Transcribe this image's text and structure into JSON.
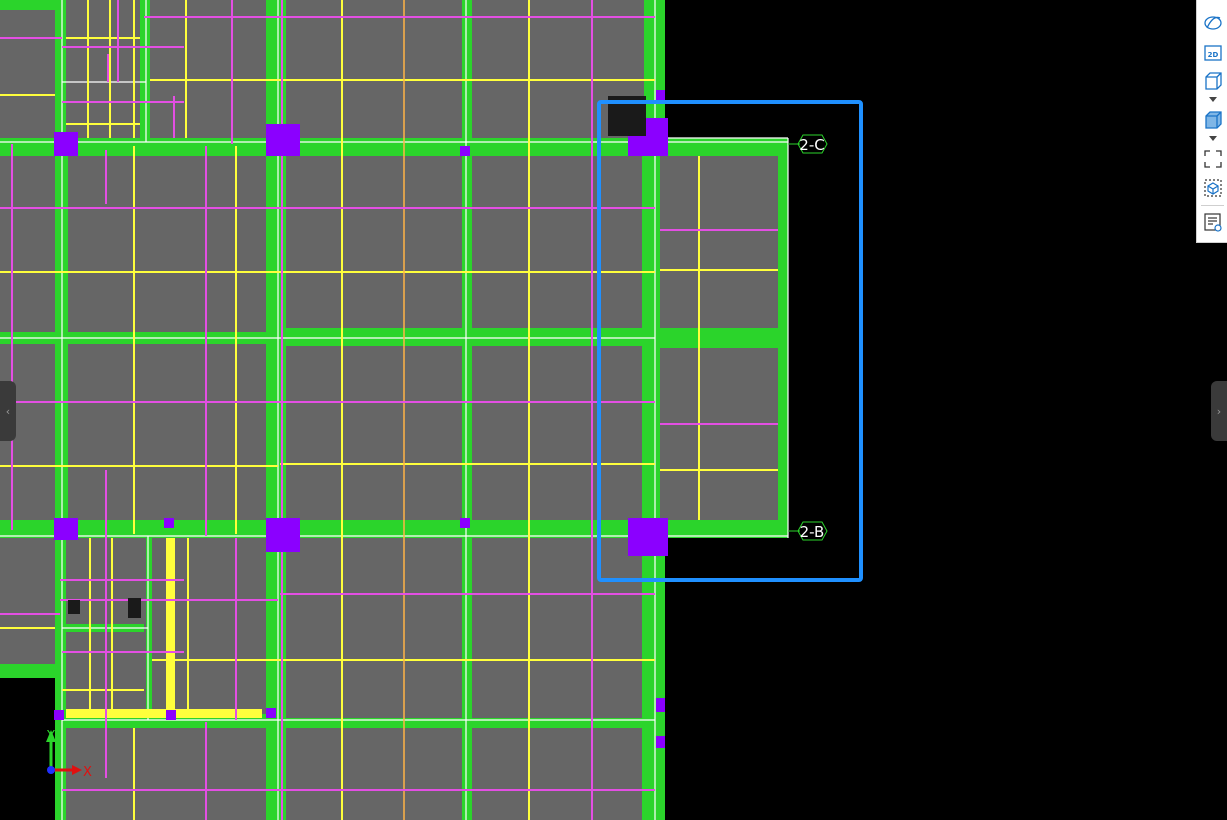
{
  "grid_markers": [
    {
      "id": "marker-2C",
      "label": "2-C"
    },
    {
      "id": "marker-2B",
      "label": "2-B"
    }
  ],
  "axis_gizmo": {
    "x_label": "X",
    "y_label": "Y"
  },
  "toolbar": {
    "buttons": [
      {
        "name": "orbit-button",
        "icon": "orbit-icon"
      },
      {
        "name": "view-2d-button",
        "icon": "2d-icon",
        "text": "2D"
      },
      {
        "name": "view-3d-wireframe-button",
        "icon": "cube-outline-icon"
      },
      {
        "name": "view-3d-shaded-button",
        "icon": "cube-shaded-icon"
      },
      {
        "name": "fit-view-button",
        "icon": "fit-frame-icon"
      },
      {
        "name": "section-box-button",
        "icon": "section-box-icon"
      },
      {
        "name": "properties-button",
        "icon": "properties-panel-icon"
      }
    ]
  },
  "colors": {
    "slab": "#666666",
    "beam": "#2bd42b",
    "column": "#8b00ff",
    "rebar_x": "#e34fe3",
    "rebar_y": "#ffff3c",
    "selection": "#1f90ff",
    "background": "#000000"
  }
}
